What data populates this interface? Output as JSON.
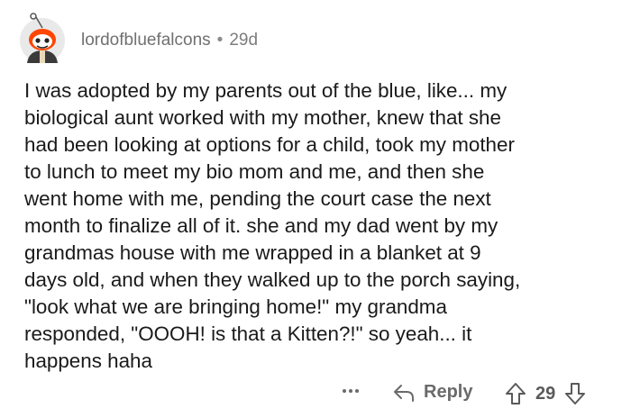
{
  "comment": {
    "username": "lordofbluefalcons",
    "separator": "•",
    "age": "29d",
    "avatar_icon": "reddit-snoo-avatar-icon",
    "body": "I was adopted by my parents out of the blue, like... my\nbiological aunt worked with my mother, knew that she\nhad been looking at options for a child, took my mother\nto lunch to meet my bio mom and me, and then she\nwent home with me, pending the court case the next\nmonth to finalize all of it. she and my dad went by my\ngrandmas house with me wrapped in a blanket at 9\ndays old, and when they walked up to the porch saying,\n\"look what we are bringing home!\" my grandma\nresponded, \"OOOH! is that a Kitten?!\" so yeah... it\nhappens haha"
  },
  "actions": {
    "more_icon": "ellipsis-icon",
    "reply_icon": "reply-arrow-icon",
    "reply_label": "Reply",
    "upvote_icon": "upvote-arrow-icon",
    "score": "29",
    "downvote_icon": "downvote-arrow-icon"
  },
  "colors": {
    "avatar_accent": "#ff4500",
    "meta_text": "#7c7c7c",
    "body_text": "#1a1a1b",
    "action_text": "#6a6a6a"
  }
}
